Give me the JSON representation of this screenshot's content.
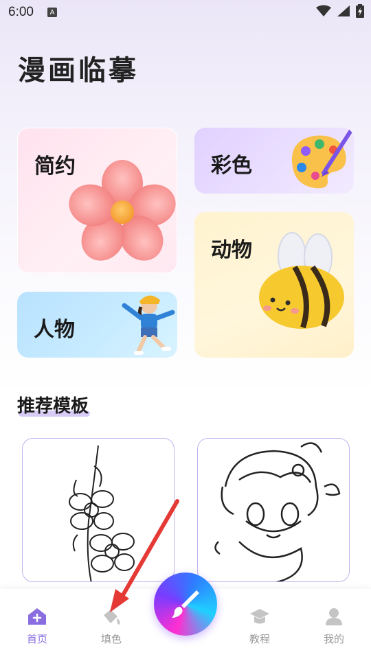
{
  "status_bar": {
    "time": "6:00",
    "a_label": "A"
  },
  "header": {
    "title": "漫画临摹"
  },
  "categories": {
    "simple": "简约",
    "color": "彩色",
    "animal": "动物",
    "people": "人物"
  },
  "recommended": {
    "title": "推荐模板"
  },
  "bottom_nav": {
    "home": "首页",
    "fill": "填色",
    "tutorial": "教程",
    "mine": "我的"
  },
  "colors": {
    "accent": "#8a6ee0",
    "arrow": "#e53935"
  }
}
